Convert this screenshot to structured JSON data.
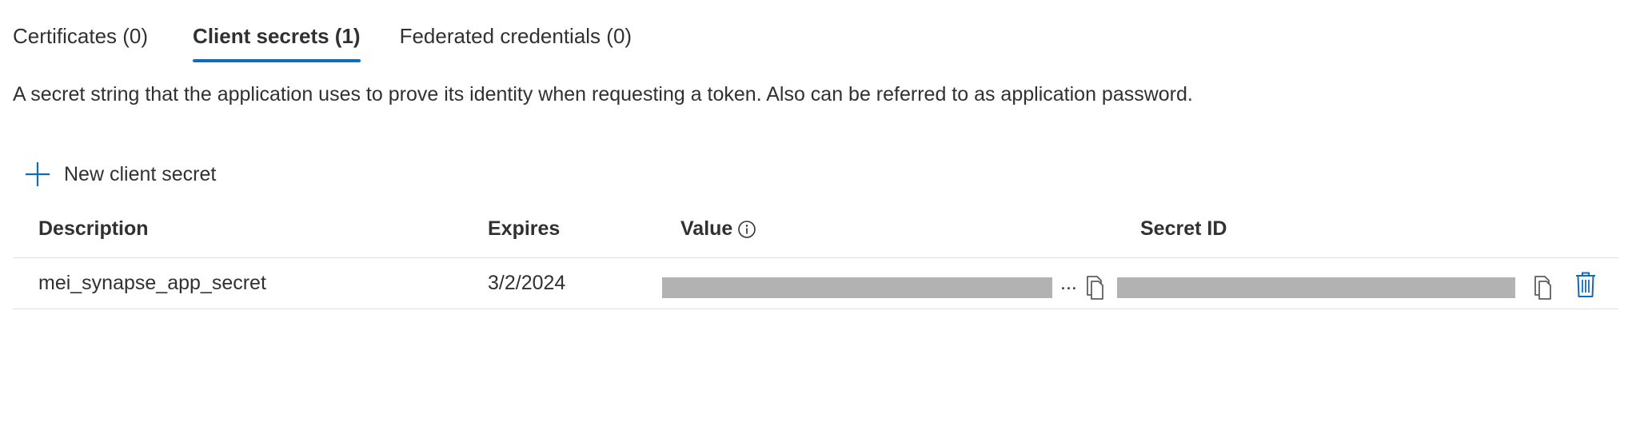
{
  "tabs": [
    {
      "label": "Certificates (0)",
      "active": false
    },
    {
      "label": "Client secrets (1)",
      "active": true
    },
    {
      "label": "Federated credentials (0)",
      "active": false
    }
  ],
  "description": "A secret string that the application uses to prove its identity when requesting a token. Also can be referred to as application password.",
  "toolbar": {
    "new_secret_label": "New client secret"
  },
  "table": {
    "columns": [
      "Description",
      "Expires",
      "Value",
      "Secret ID"
    ],
    "rows": [
      {
        "description": "mei_synapse_app_secret",
        "expires": "3/2/2024",
        "value_ellipsis": "..."
      }
    ]
  },
  "icons": {
    "new_secret": "plus-icon",
    "value_info": "info-icon",
    "copy_value": "copy-icon",
    "copy_secret_id": "copy-icon",
    "delete": "trash-icon"
  },
  "colors": {
    "accent": "#0f6cbd",
    "text": "#323130",
    "divider": "#e1dfdd",
    "redaction": "#b3b2b2"
  }
}
